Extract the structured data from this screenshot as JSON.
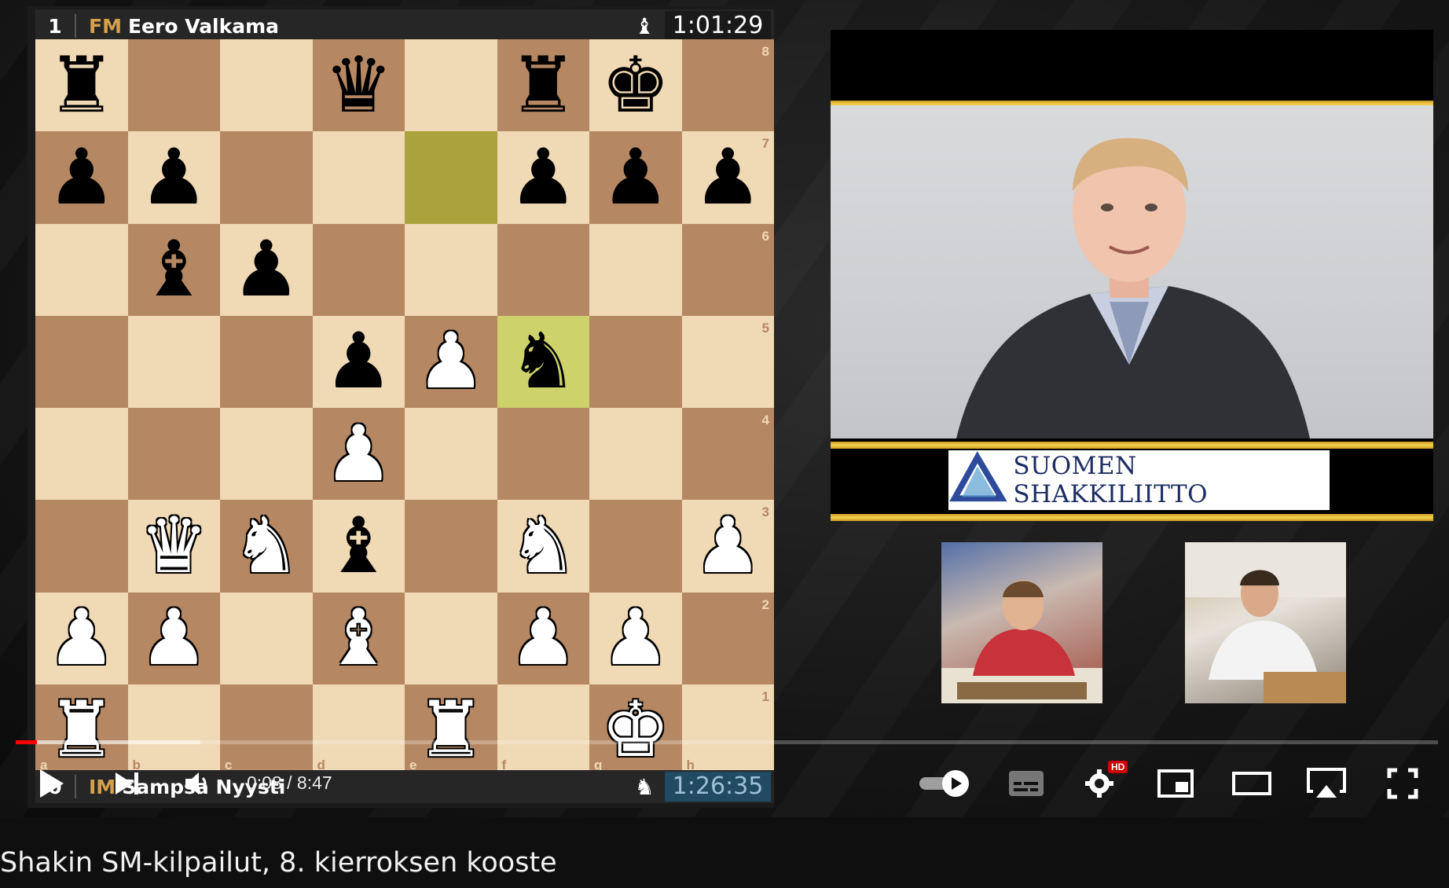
{
  "video": {
    "title": "Shakin SM-kilpailut, 8. kierroksen kooste",
    "current_time": "0:08",
    "duration": "8:47",
    "time_display": "0:08 / 8:47",
    "progress_fraction": 0.015,
    "buffered_fraction": 0.13,
    "hd_badge": "HD"
  },
  "chess": {
    "top_player": {
      "rank": "1",
      "title": "FM",
      "name": "Eero Valkama",
      "clock": "1:01:29",
      "turn_icon": "black-bishop-icon"
    },
    "bottom_player": {
      "rank": "0",
      "title": "IM",
      "name": "Sampsa Nyysti",
      "clock": "1:26:35",
      "turn_icon": "black-knight-icon"
    },
    "files": [
      "a",
      "b",
      "c",
      "d",
      "e",
      "f",
      "g",
      "h"
    ],
    "ranks": [
      "8",
      "7",
      "6",
      "5",
      "4",
      "3",
      "2",
      "1"
    ],
    "board": [
      [
        "bR",
        "",
        "",
        "bQ",
        "",
        "bR",
        "bK",
        ""
      ],
      [
        "bP",
        "bP",
        "",
        "",
        "",
        "bP",
        "bP",
        "bP"
      ],
      [
        "",
        "bB",
        "bP",
        "",
        "",
        "",
        "",
        ""
      ],
      [
        "",
        "",
        "",
        "bP",
        "wP",
        "bN",
        "",
        ""
      ],
      [
        "",
        "",
        "",
        "wP",
        "",
        "",
        "",
        ""
      ],
      [
        "",
        "wQ",
        "wN",
        "bB",
        "",
        "wN",
        "",
        "wP"
      ],
      [
        "wP",
        "wP",
        "",
        "wB",
        "",
        "wP",
        "wP",
        ""
      ],
      [
        "wR",
        "",
        "",
        "",
        "wR",
        "",
        "wK",
        ""
      ]
    ],
    "highlighted_squares": [
      "e7",
      "f5"
    ]
  },
  "broadcast": {
    "logo_text": "SUOMEN SHAKKILIITTO",
    "gold_color": "#e6bc2f"
  },
  "colors": {
    "light_square": "#f0d9b5",
    "dark_square": "#b58863",
    "progress_played": "#ff0000"
  }
}
